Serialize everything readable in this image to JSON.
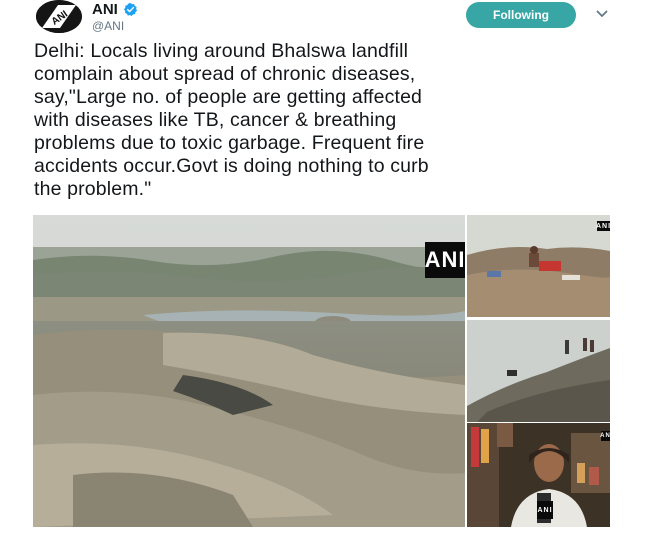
{
  "tweet": {
    "author_name": "ANI",
    "author_handle": "@ANI",
    "avatar_logo_text": "ANI",
    "follow_button_label": "Following",
    "text": "Delhi: Locals living around Bhalswa landfill\ncomplain about spread of chronic diseases,\nsay,\"Large no. of people are getting affected\nwith diseases like TB, cancer & breathing\nproblems due to toxic garbage. Frequent fire\naccidents occur.Govt is doing nothing to curb\nthe problem.\""
  },
  "media": {
    "watermark_text": "ANI",
    "main_photo_watermark": "ANI",
    "thumb_watermark": "AN"
  },
  "icons": {
    "verified": "verified-badge-icon",
    "caret": "chevron-down-icon",
    "avatar": "ani-logo"
  },
  "colors": {
    "follow_button_bg": "#39a6a6",
    "verified_blue": "#1da1f2",
    "handle_gray": "#657786"
  }
}
